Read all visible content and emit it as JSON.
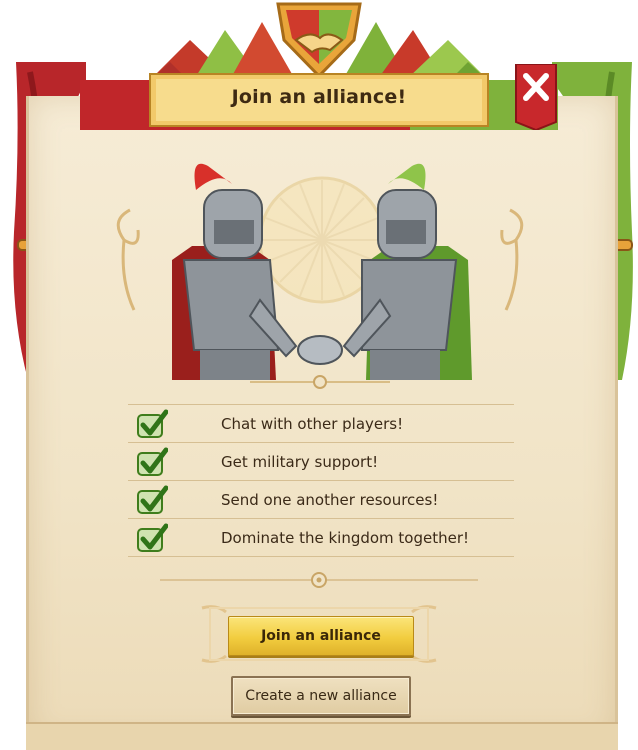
{
  "dialog": {
    "title": "Join an alliance!",
    "close_icon": "close-x-icon",
    "emblem_icon": "handshake-emblem-icon"
  },
  "benefits": [
    {
      "icon": "check-icon",
      "label": "Chat with other players!"
    },
    {
      "icon": "check-icon",
      "label": "Get military support!"
    },
    {
      "icon": "check-icon",
      "label": "Send one another resources!"
    },
    {
      "icon": "check-icon",
      "label": "Dominate the kingdom together!"
    }
  ],
  "actions": {
    "join_label": "Join an alliance",
    "create_label": "Create a new alliance"
  },
  "colors": {
    "parchment": "#f3e7cc",
    "alliance_red": "#c0262a",
    "alliance_green": "#7bb23a",
    "gold": "#f2cd3f"
  }
}
